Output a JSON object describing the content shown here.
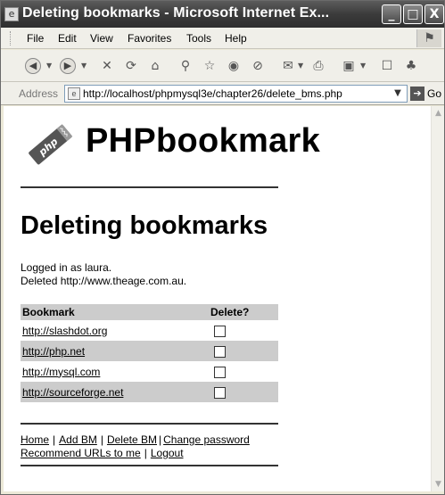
{
  "window": {
    "title": "Deleting bookmarks - Microsoft Internet Ex...",
    "min_glyph": "_",
    "max_glyph": "□",
    "close_glyph": "X"
  },
  "menu": {
    "items": [
      "File",
      "Edit",
      "View",
      "Favorites",
      "Tools",
      "Help"
    ]
  },
  "toolbar": {
    "icons": [
      "back-icon",
      "forward-icon",
      "stop-icon",
      "refresh-icon",
      "home-icon",
      "search-icon",
      "favorites-icon",
      "media-icon",
      "history-icon",
      "mail-icon",
      "print-icon",
      "edit-icon",
      "discuss-icon",
      "messenger-icon"
    ]
  },
  "address": {
    "label": "Address",
    "url": "http://localhost/phpmysql3e/chapter26/delete_bms.php",
    "go_label": "Go"
  },
  "page": {
    "site_title": "PHPbookmark",
    "logo_text": "php",
    "heading": "Deleting bookmarks",
    "logged_in": "Logged in as laura.",
    "deleted": "Deleted http://www.theage.com.au.",
    "table": {
      "col_bookmark": "Bookmark",
      "col_delete": "Delete?",
      "rows": [
        {
          "url": "http://slashdot.org",
          "checked": false
        },
        {
          "url": "http://php.net",
          "checked": false
        },
        {
          "url": "http://mysql.com",
          "checked": false
        },
        {
          "url": "http://sourceforge.net",
          "checked": false
        }
      ]
    },
    "footer": {
      "home": "Home",
      "add_bm": "Add BM",
      "delete_bm": "Delete BM",
      "change_password": "Change password",
      "recommend": "Recommend URLs to me",
      "logout": "Logout",
      "sep": "|"
    }
  }
}
